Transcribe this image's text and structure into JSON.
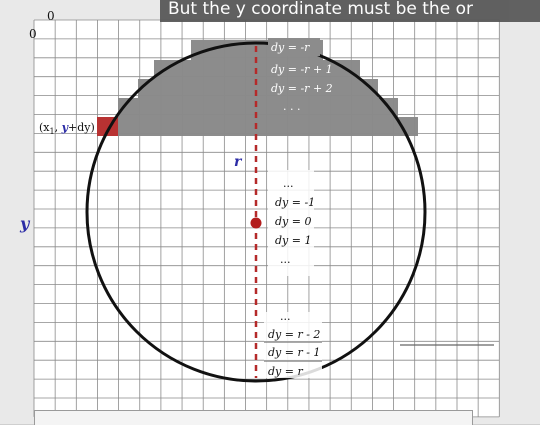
{
  "caption": {
    "text": "But the y coordinate must be the or"
  },
  "axes": {
    "x_origin": "0",
    "y_origin": "0",
    "y_label": "y",
    "top_label": "y",
    "radius_label": "r"
  },
  "point_label": {
    "prefix": "(x",
    "sub": "1",
    "mid": ", ",
    "var": "y",
    "rest": "+dy)"
  },
  "dy_top": [
    "dy = -r",
    "dy = -r + 1",
    "dy = -r + 2",
    ". . ."
  ],
  "dy_mid": [
    "...",
    "dy = -1",
    "dy =  0",
    "dy = 1",
    "..."
  ],
  "dy_bottom": [
    "...",
    "dy = r - 2",
    "dy = r - 1",
    "dy = r"
  ],
  "colors": {
    "shade": "#8c8c8c",
    "highlight": "#b83232",
    "center": "#b31d1d",
    "dash": "#b52a2a",
    "accent": "#2b2ba6"
  }
}
